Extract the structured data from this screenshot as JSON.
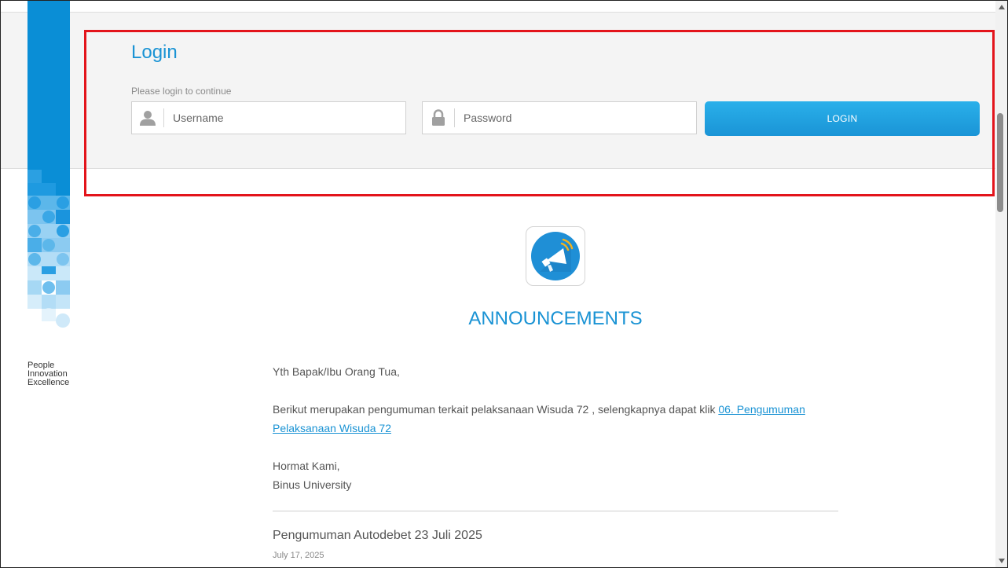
{
  "brand": {
    "tagline": [
      "People",
      "Innovation",
      "Excellence"
    ],
    "colors": {
      "primary": "#0a8ed6",
      "light": "#8cc8ee"
    }
  },
  "login": {
    "title": "Login",
    "subtitle": "Please login to continue",
    "username_placeholder": "Username",
    "password_placeholder": "Password",
    "button_label": "LOGIN",
    "highlight_color": "#e3141b"
  },
  "announcements": {
    "icon": "megaphone-icon",
    "title": "ANNOUNCEMENTS",
    "greeting": "Yth Bapak/Ibu Orang Tua,",
    "body_text": "Berikut merupakan pengumuman terkait pelaksanaan Wisuda 72 , selengkapnya dapat klik ",
    "link_text": "06. Pengumuman Pelaksanaan Wisuda 72",
    "closing_1": "Hormat Kami,",
    "closing_2": "Binus University",
    "items": [
      {
        "title": "Pengumuman Autodebet 23 Juli 2025",
        "date": "July 17, 2025"
      }
    ]
  },
  "colors": {
    "accent": "#1a93d4",
    "button": "#1a94d6"
  }
}
